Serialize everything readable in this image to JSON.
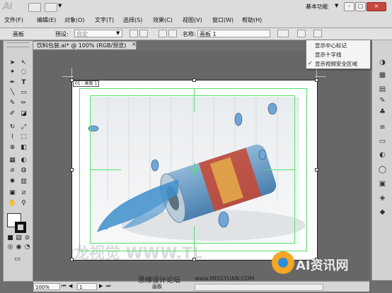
{
  "app": {
    "logo": "Ai"
  },
  "menu": [
    "文件(F)",
    "编辑(E)",
    "对象(O)",
    "文字(T)",
    "选择(S)",
    "效果(C)",
    "视图(V)",
    "窗口(W)",
    "帮助(H)"
  ],
  "workspace": {
    "label": "基本功能",
    "caret": "▼"
  },
  "window_buttons": {
    "min": "–",
    "max": "□",
    "close": "×"
  },
  "controlbar": {
    "artboard_label": "画板",
    "preset_label": "预设:",
    "preset_value": "自定",
    "name_label": "名称:",
    "name_value": "画板 1"
  },
  "document": {
    "tab_title": "饮料包装.ai* @ 100% (RGB/预览)",
    "tab_close": "×",
    "artboard_label": "01 - 画板 1"
  },
  "popup_menu": {
    "items": [
      "显示中心标记",
      "显示十字线",
      "显示视频安全区域"
    ],
    "checked_index": 2,
    "check_mark": "✓"
  },
  "status": {
    "zoom": "100%",
    "page": "1",
    "mode": "画板"
  },
  "watermarks": {
    "left_brand": "腾龙视觉 WWW.TL",
    "forum": "思缘设计论坛",
    "site": "www.MISSYUAN.COM",
    "ai_logo": "AI资讯网"
  },
  "colors": {
    "chrome": "#dcdcdc",
    "canvas": "#676767",
    "guide_green": "#55e066",
    "water_blue": "#3f8fcc"
  }
}
